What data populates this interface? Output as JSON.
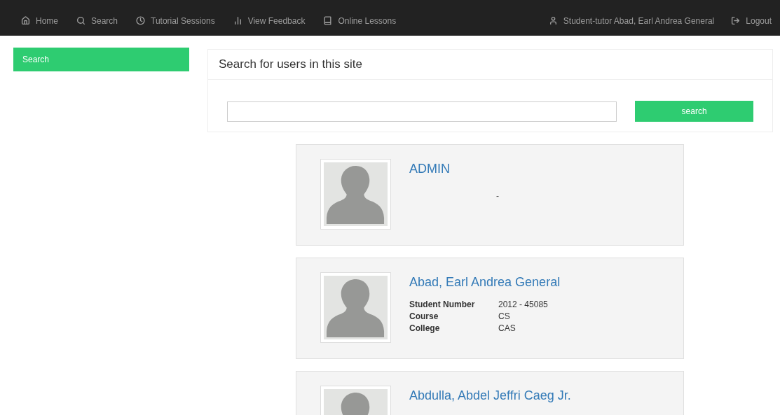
{
  "navbar": {
    "items": [
      {
        "label": "Home"
      },
      {
        "label": "Search"
      },
      {
        "label": "Tutorial Sessions"
      },
      {
        "label": "View Feedback"
      },
      {
        "label": "Online Lessons"
      }
    ],
    "right_items": [
      {
        "label": "Student-tutor Abad, Earl Andrea General"
      },
      {
        "label": "Logout"
      }
    ]
  },
  "sidebar": {
    "items": [
      {
        "label": "Search",
        "selected": true
      }
    ]
  },
  "search_panel": {
    "title": "Search for users in this site",
    "button": "search"
  },
  "users": [
    {
      "name": "ADMIN",
      "subtitle": "-"
    },
    {
      "name": "Abad, Earl Andrea General",
      "details": [
        {
          "label": "Student Number",
          "value": "2012 - 45085"
        },
        {
          "label": "Course",
          "value": "CS"
        },
        {
          "label": "College",
          "value": "CAS"
        }
      ]
    },
    {
      "name": "Abdulla, Abdel Jeffri Caeg Jr."
    }
  ]
}
